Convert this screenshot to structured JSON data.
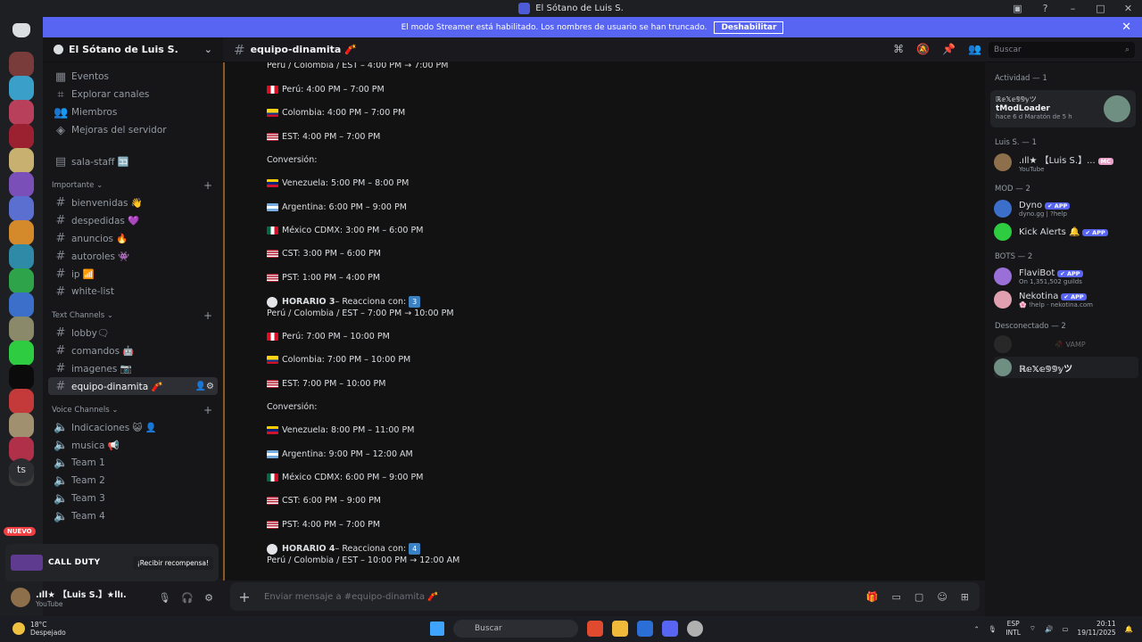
{
  "window": {
    "title": "El Sótano de Luis S."
  },
  "banner": {
    "text": "El modo Streamer está habilitado. Los nombres de usuario se han truncado.",
    "button": "Deshabilitar"
  },
  "rail": {
    "nuevo": "NUEVO",
    "ts_label": "ts"
  },
  "server": {
    "name": "El Sótano de Luis S."
  },
  "sidebar": {
    "top_items": [
      "Eventos",
      "Explorar canales",
      "Miembros",
      "Mejoras del servidor"
    ],
    "staff": "sala-staff 🈁",
    "cat_important": "Importante",
    "important": [
      "bienvenidas 👋",
      "despedidas 💜",
      "anuncios 🔥",
      "autoroles 👾",
      "ip 📶",
      "white-list"
    ],
    "cat_text": "Text Channels",
    "text": [
      "lobby🗨",
      "comandos 🤖",
      "imagenes 📷",
      "equipo-dinamita 🧨"
    ],
    "cat_voice": "Voice Channels",
    "voice": [
      "Indicaciones 😺 👤",
      "musica 📢",
      "Team 1",
      "Team 2",
      "Team 3",
      "Team 4"
    ]
  },
  "promo": {
    "title": "CALL DUTY",
    "button": "¡Recibir recompensa!"
  },
  "user": {
    "name": ".ıll★ 【Luis S.】★llı.",
    "status": "YouTube"
  },
  "channel": {
    "name": "equipo-dinamita 🧨",
    "search": "Buscar",
    "composer": "Enviar mensaje a #equipo-dinamita 🧨"
  },
  "messages": [
    {
      "text": "Perú / Colombia / EST – 4:00 PM → 7:00 PM"
    },
    {
      "text": "Perú: 4:00 PM – 7:00 PM",
      "flag": "pe"
    },
    {
      "text": "Colombia: 4:00 PM – 7:00 PM",
      "flag": "co"
    },
    {
      "text": "EST: 4:00 PM – 7:00 PM",
      "flag": "us"
    },
    {
      "text": "Conversión:"
    },
    {
      "text": "Venezuela: 5:00 PM – 8:00 PM",
      "flag": "ve"
    },
    {
      "text": "Argentina: 6:00 PM – 9:00 PM",
      "flag": "ar"
    },
    {
      "text": "México CDMX: 3:00 PM – 6:00 PM",
      "flag": "mx"
    },
    {
      "text": "CST: 3:00 PM – 6:00 PM",
      "flag": "us"
    },
    {
      "text": "PST: 1:00 PM – 4:00 PM",
      "flag": "us"
    },
    {
      "head": "HORARIO 3",
      "rest": " – Reacciona con:",
      "num": "3"
    },
    {
      "text": "Perú / Colombia / EST – 7:00 PM → 10:00 PM"
    },
    {
      "text": "Perú: 7:00 PM – 10:00 PM",
      "flag": "pe"
    },
    {
      "text": "Colombia: 7:00 PM – 10:00 PM",
      "flag": "co"
    },
    {
      "text": "EST: 7:00 PM – 10:00 PM",
      "flag": "us"
    },
    {
      "text": "Conversión:"
    },
    {
      "text": "Venezuela: 8:00 PM – 11:00 PM",
      "flag": "ve"
    },
    {
      "text": "Argentina: 9:00 PM – 12:00 AM",
      "flag": "ar"
    },
    {
      "text": "México CDMX: 6:00 PM – 9:00 PM",
      "flag": "mx"
    },
    {
      "text": "CST: 6:00 PM – 9:00 PM",
      "flag": "us"
    },
    {
      "text": "PST: 4:00 PM – 7:00 PM",
      "flag": "us"
    },
    {
      "head": "HORARIO 4",
      "rest": " – Reacciona con:",
      "num": "4"
    },
    {
      "text": "Perú / Colombia / EST – 10:00 PM → 12:00 AM"
    }
  ],
  "members": {
    "activity_head": "Actividad — 1",
    "activity": {
      "user": "ℝ𝕖𝕏𝕖𝟡𝟡𝕪ツ",
      "game": "tModLoader",
      "meta": "hace 6 d   Maratón de 5 h"
    },
    "owner_head": "Luis S. — 1",
    "owner": {
      "name": ".ıll★ 【Luis S.】...",
      "tag": "MC",
      "sub": "YouTube"
    },
    "mod_head": "MOD — 2",
    "mods": [
      {
        "name": "Dyno",
        "tag": "✔ APP",
        "sub": "dyno.gg | ?help"
      },
      {
        "name": "Kick Alerts 🔔",
        "tag": "✔ APP",
        "sub": ""
      }
    ],
    "bots_head": "BOTS — 2",
    "bots": [
      {
        "name": "FlaviBot",
        "tag": "✔ APP",
        "sub": "On 1,351,502 guilds"
      },
      {
        "name": "Nekotina",
        "tag": "✔ APP",
        "sub": "🌸 !help · nekotina.com"
      }
    ],
    "off_head": "Desconectado — 2",
    "offline": [
      {
        "name": "🥀 VAMP"
      },
      {
        "name": "ℝ𝕖𝕏𝕖𝟡𝟡𝕪ツ"
      }
    ]
  },
  "taskbar": {
    "temp": "18°C",
    "weather": "Despejado",
    "search": "Buscar",
    "lang1": "ESP",
    "lang2": "INTL",
    "time": "20:11",
    "date": "19/11/2025"
  },
  "colors": {
    "accent": "#5865f2",
    "bg": "#121213"
  }
}
